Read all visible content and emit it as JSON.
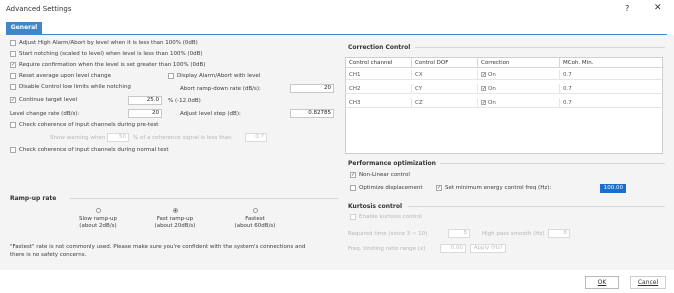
{
  "window": {
    "title": "Advanced Settings",
    "help": "?",
    "close": "✕"
  },
  "tab": {
    "label": "General"
  },
  "left": {
    "cb_adjust_high_alarm": {
      "label": "Adjust High Alarm/Abort by level when it is less than 100% (0dB)",
      "checked": false
    },
    "cb_start_notching": {
      "label": "Start notching (scaled to level) when level is less than 100% (0dB)",
      "checked": false
    },
    "cb_require_confirmation": {
      "label": "Require confirmation when the level is set greater than 100% (0dB)",
      "checked": true
    },
    "cb_reset_average": {
      "label": "Reset average upon level change",
      "checked": false
    },
    "cb_display_alarm": {
      "label": "Display Alarm/Abort with level",
      "checked": false
    },
    "cb_disable_low_limits": {
      "label": "Disable Control low limits while notching",
      "checked": false
    },
    "abort_ramp_label": "Abort ramp-down rate (dB/s):",
    "abort_ramp_value": "20",
    "cb_continue_target": {
      "label": "Continue target level",
      "checked": true
    },
    "continue_value": "25.0",
    "continue_unit": "% (-12.0dB)",
    "level_change_label": "Level change rate (dB/s):",
    "level_change_value": "20",
    "adjust_step_label": "Adjust level step (dB):",
    "adjust_step_value": "0.82785",
    "cb_coherence_pretest": {
      "label": "Check coherence of input channels during pre-test",
      "checked": false
    },
    "warning_prefix": "Show warning when",
    "warning_value": "50",
    "warning_mid": "% of a coherence signal is less than",
    "warning_value2": "0.7",
    "cb_coherence_normal": {
      "label": "Check coherence of input channels during normal test",
      "checked": false
    }
  },
  "ramp": {
    "title": "Ramp-up rate",
    "options": [
      {
        "line1": "Slow ramp-up",
        "line2": "(about 2dB/s)",
        "selected": false
      },
      {
        "line1": "Fast ramp-up",
        "line2": "(about 20dB/s)",
        "selected": true
      },
      {
        "line1": "Fastest",
        "line2": "(about 60dB/s)",
        "selected": false
      }
    ],
    "note1": "\"Fastest\" rate is not commonly used. Please make sure you're confident with the system's connections and",
    "note2": "there is no safety concerns."
  },
  "correction": {
    "title": "Correction Control",
    "headers": [
      "Control channel",
      "Control DOF",
      "Correction",
      "MCoh. Min."
    ],
    "rows": [
      {
        "channel": "CH1",
        "dof": "CX",
        "correction": "On",
        "checked": true,
        "mcoh": "0.7"
      },
      {
        "channel": "CH2",
        "dof": "CY",
        "correction": "On",
        "checked": true,
        "mcoh": "0.7"
      },
      {
        "channel": "CH3",
        "dof": "CZ",
        "correction": "On",
        "checked": true,
        "mcoh": "0.7"
      }
    ]
  },
  "performance": {
    "title": "Performance optimization",
    "cb_nonlinear": {
      "label": "Non-Linear control",
      "checked": true
    },
    "cb_optimize": {
      "label": "Optimize displacement",
      "checked": false
    },
    "cb_min_energy": {
      "label": "Set minimum energy control freq (Hz):",
      "checked": true
    },
    "min_energy_value": "100.00"
  },
  "kurtosis": {
    "title": "Kurtosis control",
    "cb_enable": {
      "label": "Enable kurtosis control",
      "checked": false
    },
    "required_label": "Required time (since 3 ~ 10)",
    "required_value": "8",
    "high_pass_label": "High pass smooth (Hz)",
    "high_pass_value": "8",
    "freq_label": "Freq. limiting ratio range (x)",
    "freq_value": "0.00",
    "apply_label": "Apply (Hz)"
  },
  "buttons": {
    "ok": "OK",
    "cancel": "Cancel"
  }
}
